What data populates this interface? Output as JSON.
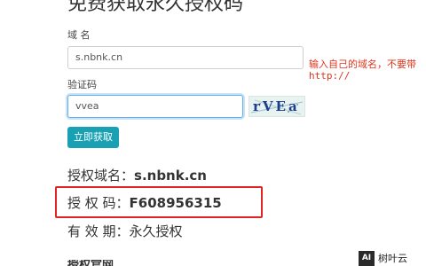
{
  "page": {
    "title": "免费获取永久授权码"
  },
  "form": {
    "domain_label": "域 名",
    "domain_value": "s.nbnk.cn",
    "domain_hint_line1": "输入自己的域名，不要带",
    "domain_hint_line2": "http://",
    "captcha_label": "验证码",
    "captcha_value": "vvea",
    "captcha_image_text": "rVEa",
    "submit_label": "立即获取"
  },
  "result": {
    "domain_label": "授权域名：",
    "domain_value": "s.nbnk.cn",
    "code_label": "授 权 码：",
    "code_value": "F608956315",
    "validity_label": "有 效 期：",
    "validity_value": "永久授权"
  },
  "section": {
    "next_title": "授权官网"
  },
  "watermark": {
    "logo_text": "AI",
    "site_name": "树叶云"
  },
  "colors": {
    "button": "#1aa0b3",
    "hint": "#e0341e",
    "highlight_border": "#e02424",
    "input_focus": "#66afe9"
  }
}
